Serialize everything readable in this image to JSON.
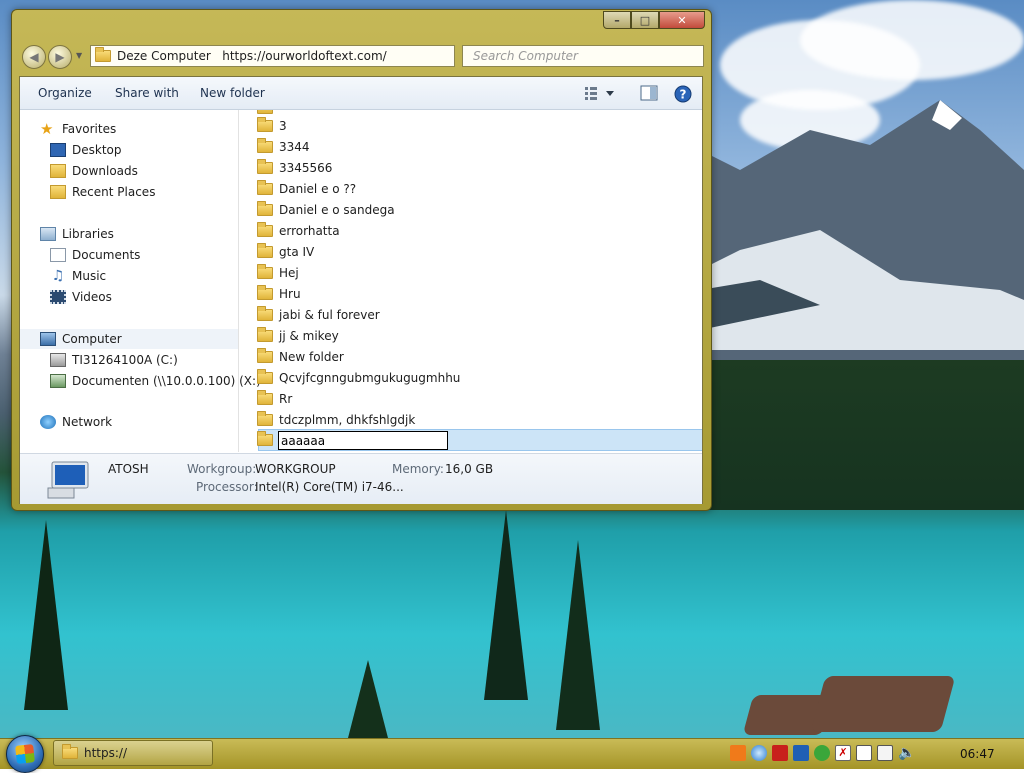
{
  "window": {
    "address": "Deze Computer   https://ourworldoftext.com/",
    "search_placeholder": "Search Computer",
    "caption": {
      "minimize": "–",
      "maximize": "□",
      "close": "✕"
    }
  },
  "toolbar": {
    "organize": "Organize",
    "share_with": "Share with",
    "new_folder": "New folder"
  },
  "navpane": {
    "favorites": "Favorites",
    "desktop": "Desktop",
    "downloads": "Downloads",
    "recent_places": "Recent Places",
    "libraries": "Libraries",
    "documents": "Documents",
    "music": "Music",
    "videos": "Videos",
    "computer": "Computer",
    "drive_c": "TI31264100A (C:)",
    "drive_x": "Documenten (\\\\10.0.0.100) (X:)",
    "network": "Network"
  },
  "files": [
    "3",
    "3344",
    "3345566",
    "Daniel e o ??",
    "Daniel e o sandega",
    "errorhatta",
    "gta IV",
    "Hej",
    "Hru",
    "jabi & ful forever",
    "jj & mikey",
    "New folder",
    "Qcvjfcgnngubmgukugugmhhu",
    "Rr",
    "tdczplmm, dhkfshlgdjk"
  ],
  "rename_value": "aaaaaa",
  "details": {
    "name": "ATOSH",
    "workgroup_label": "Workgroup:",
    "workgroup": "WORKGROUP",
    "memory_label": "Memory:",
    "memory": "16,0 GB",
    "processor_label": "Processor:",
    "processor": "Intel(R) Core(TM) i7-46..."
  },
  "taskbar": {
    "task_label": "https://",
    "clock": "06:47"
  },
  "colors": {
    "window_frame": "#b5a942",
    "taskbar": "#b8aa3e",
    "selection": "#cce4f7"
  }
}
